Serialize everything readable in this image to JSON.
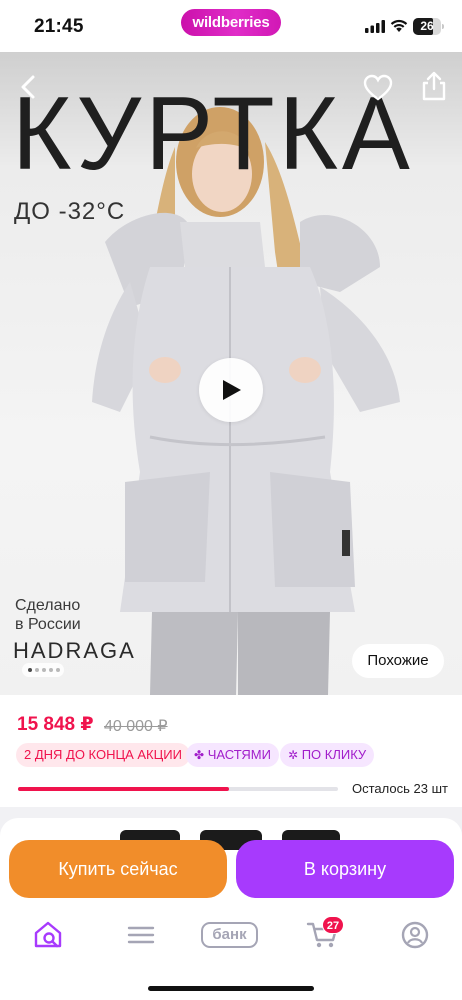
{
  "status_bar": {
    "time": "21:45",
    "brand": "wildberries",
    "battery": "26"
  },
  "hero": {
    "heading": "КУРТКА",
    "subheading": "ДО -32°C",
    "made_in_line1": "Сделано",
    "made_in_line2": "в России",
    "brand_name": "HADRAGA",
    "similar_label": "Похожие",
    "background_color": "#eeeeee"
  },
  "price": {
    "current": "15 848 ₽",
    "old": "40 000 ₽",
    "badges": {
      "sale": "2 ДНЯ ДО КОНЦА АКЦИИ",
      "parts": "ЧАСТЯМИ",
      "click": "ПО КЛИКУ"
    },
    "stock_text": "Осталось 23 шт",
    "stock_progress": 0.66,
    "accent_color": "#f0134d"
  },
  "actions": {
    "buy_now": "Купить сейчас",
    "add_to_cart": "В корзину",
    "buy_now_color": "#f18d2a",
    "cart_color": "#a73afd"
  },
  "tab_bar": {
    "items": [
      {
        "name": "home",
        "icon": "home-search-icon",
        "active": true
      },
      {
        "name": "catalog",
        "icon": "menu-icon",
        "active": false
      },
      {
        "name": "bank",
        "icon": "bank-icon",
        "label": "банк",
        "active": false
      },
      {
        "name": "cart",
        "icon": "cart-icon",
        "active": false
      },
      {
        "name": "profile",
        "icon": "profile-icon",
        "active": false
      }
    ],
    "cart_count": "27",
    "active_color": "#a73afd"
  }
}
